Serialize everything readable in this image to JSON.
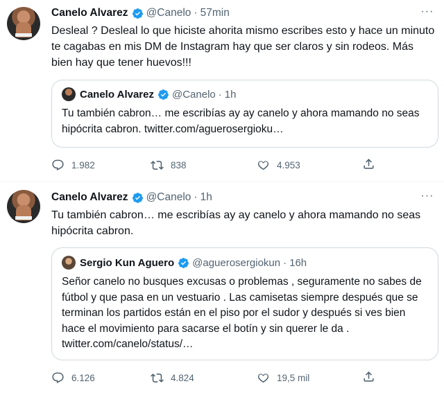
{
  "tweets": [
    {
      "author_name": "Canelo Alvarez",
      "handle": "@Canelo",
      "time": "57min",
      "text": "Desleal ? Desleal lo que hiciste ahorita mismo escribes esto y hace un minuto te cagabas en mis DM de Instagram hay que ser claros y sin rodeos. Más bien hay que tener huevos!!!",
      "quote": {
        "author_name": "Canelo Alvarez",
        "handle": "@Canelo",
        "time": "1h",
        "text": "Tu también cabron… me escribías ay ay canelo y ahora mamando no seas hipócrita cabron. twitter.com/aguerosergioku…"
      },
      "replies": "1.982",
      "retweets": "838",
      "likes": "4.953"
    },
    {
      "author_name": "Canelo Alvarez",
      "handle": "@Canelo",
      "time": "1h",
      "text": "Tu también cabron… me escribías ay ay canelo y ahora mamando no seas hipócrita cabron.",
      "quote": {
        "author_name": "Sergio Kun Aguero",
        "handle": "@aguerosergiokun",
        "time": "16h",
        "text": "Señor canelo no busques excusas o problemas , seguramente no sabes de fútbol y que pasa en un vestuario . Las camisetas siempre después que se terminan los partidos  están en el piso por el sudor y después si ves bien hace el movimiento para sacarse el botín y sin querer le da . twitter.com/canelo/status/…"
      },
      "replies": "6.126",
      "retweets": "4.824",
      "likes": "19,5 mil"
    }
  ],
  "separator": "·",
  "more_glyph": "···",
  "icons": {
    "verified": "verified-badge-icon",
    "reply": "reply-icon",
    "retweet": "retweet-icon",
    "like": "heart-icon",
    "share": "share-icon",
    "more": "more-icon"
  },
  "colors": {
    "verified": "#1d9bf0",
    "text": "#0f1419",
    "secondary": "#536471",
    "border": "#cfd9de"
  }
}
